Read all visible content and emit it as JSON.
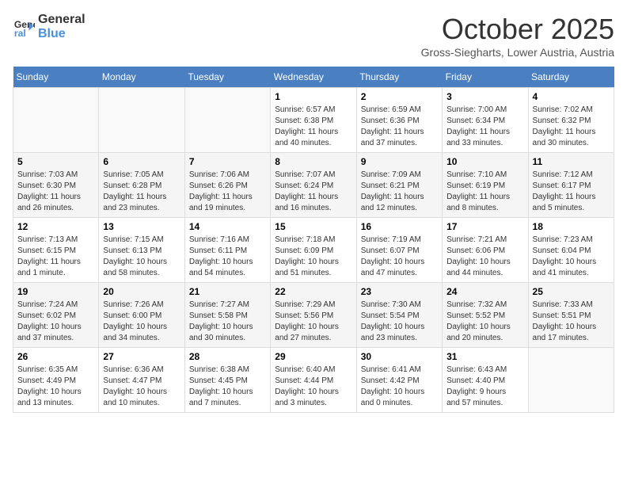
{
  "header": {
    "logo_line1": "General",
    "logo_line2": "Blue",
    "month_title": "October 2025",
    "subtitle": "Gross-Siegharts, Lower Austria, Austria"
  },
  "weekdays": [
    "Sunday",
    "Monday",
    "Tuesday",
    "Wednesday",
    "Thursday",
    "Friday",
    "Saturday"
  ],
  "weeks": [
    [
      {
        "day": "",
        "info": ""
      },
      {
        "day": "",
        "info": ""
      },
      {
        "day": "",
        "info": ""
      },
      {
        "day": "1",
        "info": "Sunrise: 6:57 AM\nSunset: 6:38 PM\nDaylight: 11 hours\nand 40 minutes."
      },
      {
        "day": "2",
        "info": "Sunrise: 6:59 AM\nSunset: 6:36 PM\nDaylight: 11 hours\nand 37 minutes."
      },
      {
        "day": "3",
        "info": "Sunrise: 7:00 AM\nSunset: 6:34 PM\nDaylight: 11 hours\nand 33 minutes."
      },
      {
        "day": "4",
        "info": "Sunrise: 7:02 AM\nSunset: 6:32 PM\nDaylight: 11 hours\nand 30 minutes."
      }
    ],
    [
      {
        "day": "5",
        "info": "Sunrise: 7:03 AM\nSunset: 6:30 PM\nDaylight: 11 hours\nand 26 minutes."
      },
      {
        "day": "6",
        "info": "Sunrise: 7:05 AM\nSunset: 6:28 PM\nDaylight: 11 hours\nand 23 minutes."
      },
      {
        "day": "7",
        "info": "Sunrise: 7:06 AM\nSunset: 6:26 PM\nDaylight: 11 hours\nand 19 minutes."
      },
      {
        "day": "8",
        "info": "Sunrise: 7:07 AM\nSunset: 6:24 PM\nDaylight: 11 hours\nand 16 minutes."
      },
      {
        "day": "9",
        "info": "Sunrise: 7:09 AM\nSunset: 6:21 PM\nDaylight: 11 hours\nand 12 minutes."
      },
      {
        "day": "10",
        "info": "Sunrise: 7:10 AM\nSunset: 6:19 PM\nDaylight: 11 hours\nand 8 minutes."
      },
      {
        "day": "11",
        "info": "Sunrise: 7:12 AM\nSunset: 6:17 PM\nDaylight: 11 hours\nand 5 minutes."
      }
    ],
    [
      {
        "day": "12",
        "info": "Sunrise: 7:13 AM\nSunset: 6:15 PM\nDaylight: 11 hours\nand 1 minute."
      },
      {
        "day": "13",
        "info": "Sunrise: 7:15 AM\nSunset: 6:13 PM\nDaylight: 10 hours\nand 58 minutes."
      },
      {
        "day": "14",
        "info": "Sunrise: 7:16 AM\nSunset: 6:11 PM\nDaylight: 10 hours\nand 54 minutes."
      },
      {
        "day": "15",
        "info": "Sunrise: 7:18 AM\nSunset: 6:09 PM\nDaylight: 10 hours\nand 51 minutes."
      },
      {
        "day": "16",
        "info": "Sunrise: 7:19 AM\nSunset: 6:07 PM\nDaylight: 10 hours\nand 47 minutes."
      },
      {
        "day": "17",
        "info": "Sunrise: 7:21 AM\nSunset: 6:06 PM\nDaylight: 10 hours\nand 44 minutes."
      },
      {
        "day": "18",
        "info": "Sunrise: 7:23 AM\nSunset: 6:04 PM\nDaylight: 10 hours\nand 41 minutes."
      }
    ],
    [
      {
        "day": "19",
        "info": "Sunrise: 7:24 AM\nSunset: 6:02 PM\nDaylight: 10 hours\nand 37 minutes."
      },
      {
        "day": "20",
        "info": "Sunrise: 7:26 AM\nSunset: 6:00 PM\nDaylight: 10 hours\nand 34 minutes."
      },
      {
        "day": "21",
        "info": "Sunrise: 7:27 AM\nSunset: 5:58 PM\nDaylight: 10 hours\nand 30 minutes."
      },
      {
        "day": "22",
        "info": "Sunrise: 7:29 AM\nSunset: 5:56 PM\nDaylight: 10 hours\nand 27 minutes."
      },
      {
        "day": "23",
        "info": "Sunrise: 7:30 AM\nSunset: 5:54 PM\nDaylight: 10 hours\nand 23 minutes."
      },
      {
        "day": "24",
        "info": "Sunrise: 7:32 AM\nSunset: 5:52 PM\nDaylight: 10 hours\nand 20 minutes."
      },
      {
        "day": "25",
        "info": "Sunrise: 7:33 AM\nSunset: 5:51 PM\nDaylight: 10 hours\nand 17 minutes."
      }
    ],
    [
      {
        "day": "26",
        "info": "Sunrise: 6:35 AM\nSunset: 4:49 PM\nDaylight: 10 hours\nand 13 minutes."
      },
      {
        "day": "27",
        "info": "Sunrise: 6:36 AM\nSunset: 4:47 PM\nDaylight: 10 hours\nand 10 minutes."
      },
      {
        "day": "28",
        "info": "Sunrise: 6:38 AM\nSunset: 4:45 PM\nDaylight: 10 hours\nand 7 minutes."
      },
      {
        "day": "29",
        "info": "Sunrise: 6:40 AM\nSunset: 4:44 PM\nDaylight: 10 hours\nand 3 minutes."
      },
      {
        "day": "30",
        "info": "Sunrise: 6:41 AM\nSunset: 4:42 PM\nDaylight: 10 hours\nand 0 minutes."
      },
      {
        "day": "31",
        "info": "Sunrise: 6:43 AM\nSunset: 4:40 PM\nDaylight: 9 hours\nand 57 minutes."
      },
      {
        "day": "",
        "info": ""
      }
    ]
  ]
}
